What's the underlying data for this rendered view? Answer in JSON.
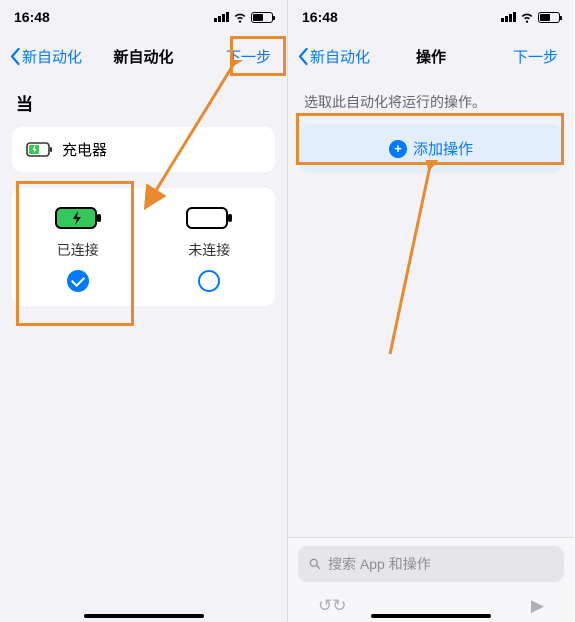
{
  "status": {
    "time": "16:48"
  },
  "left": {
    "nav": {
      "back": "新自动化",
      "title": "新自动化",
      "next": "下一步"
    },
    "sectionHeader": "当",
    "charger": "充电器",
    "options": {
      "connected": "已连接",
      "disconnected": "未连接"
    }
  },
  "right": {
    "nav": {
      "back": "新自动化",
      "title": "操作",
      "next": "下一步"
    },
    "hint": "选取此自动化将运行的操作。",
    "addAction": "添加操作",
    "searchPlaceholder": "搜索 App 和操作"
  }
}
